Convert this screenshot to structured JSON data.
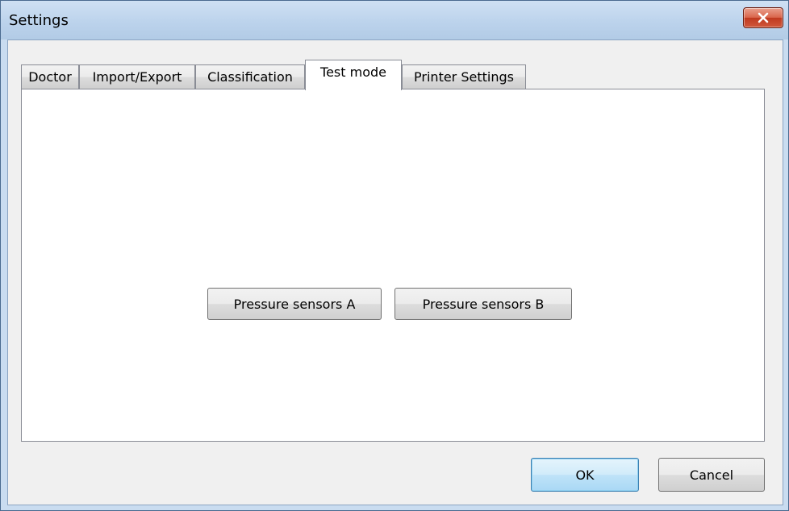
{
  "window": {
    "title": "Settings"
  },
  "tabs": [
    {
      "label": "Doctor",
      "active": false
    },
    {
      "label": "Import/Export",
      "active": false
    },
    {
      "label": "Classification",
      "active": false
    },
    {
      "label": "Test mode",
      "active": true
    },
    {
      "label": "Printer Settings",
      "active": false
    }
  ],
  "test_mode": {
    "sensor_a_label": "Pressure sensors A",
    "sensor_b_label": "Pressure sensors B"
  },
  "footer": {
    "ok_label": "OK",
    "cancel_label": "Cancel"
  },
  "colors": {
    "titlebar": "#bcd3ec",
    "close_button": "#c9452a",
    "client_bg": "#f0f0f0",
    "panel_bg": "#ffffff",
    "default_button_border": "#3c7fb1"
  }
}
